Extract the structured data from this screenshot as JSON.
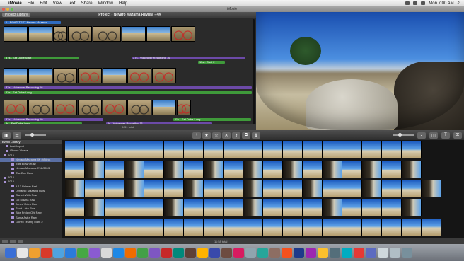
{
  "menubar": {
    "app": "iMovie",
    "items": [
      "File",
      "Edit",
      "View",
      "Text",
      "Share",
      "Window",
      "Help"
    ],
    "clock": "Mon 7:00 AM"
  },
  "window": {
    "title": "iMovie"
  },
  "project": {
    "library_button": "Project Library",
    "title": "Project - Nevaro Mazama Review - 4K",
    "duration": "1:51 total",
    "lanes": [
      "1 - ROAD TEST Nevaro Mazama",
      "37s - Eat Dobe Start",
      "37s - Voiceover Recording 16",
      "11s - Gast 2",
      "37s - Voiceover Recording 16",
      "53s - Eat Dobe Long",
      "37s - Voiceover Recording 10",
      "11s - Eat Dobe Long",
      "6s - Voiceover Recording 11",
      "9s - Eat Dobe Long"
    ]
  },
  "event_library": {
    "header": "Event Library",
    "items": [
      {
        "label": "Last Import",
        "level": "row"
      },
      {
        "label": "iPhone Videos",
        "level": "row"
      },
      {
        "label": "2013",
        "level": "yr"
      },
      {
        "label": "Nevaro Mazama 4K (Video)",
        "level": "sub",
        "selected": true
      },
      {
        "label": "This Blown Raw",
        "level": "sub"
      },
      {
        "label": "Nevaro Mazama 7/12/2013",
        "level": "sub"
      },
      {
        "label": "The Box Raw",
        "level": "sub"
      },
      {
        "label": "2014",
        "level": "yr"
      },
      {
        "label": "2013",
        "level": "yr"
      },
      {
        "label": "5-13 Palmer Park",
        "level": "sub"
      },
      {
        "label": "Dynamic Mazama Raw",
        "level": "sub"
      },
      {
        "label": "Garrett With Raw",
        "level": "sub"
      },
      {
        "label": "Go Mazna Raw",
        "level": "sub"
      },
      {
        "label": "Jones Video Raw",
        "level": "sub"
      },
      {
        "label": "Scott Lake Raw",
        "level": "sub"
      },
      {
        "label": "Bike Friday Ork Raw",
        "level": "sub"
      },
      {
        "label": "Santa Astra Raw",
        "level": "sub"
      },
      {
        "label": "GoPro Testing Mark 2",
        "level": "sub"
      }
    ]
  },
  "browser": {
    "status": "11:58 total"
  },
  "colors": {
    "green_lane": "#3f9a3a",
    "purple_lane": "#6c4aa8",
    "selected": "#5a6fa3"
  }
}
